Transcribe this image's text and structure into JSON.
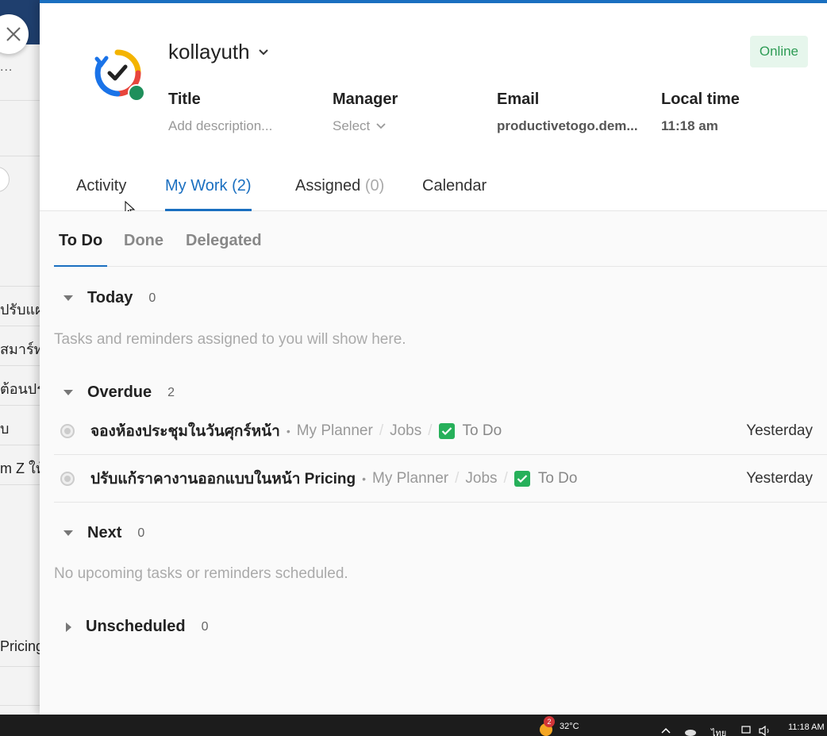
{
  "background_app": {
    "ellipsis": "...",
    "rows": [
      "ปรับแผน",
      "สมาร์ทเก็",
      "ต้อนประ",
      "บ",
      "m Z ให้",
      "Pricing"
    ]
  },
  "profile": {
    "username": "kollayuth",
    "status": "Online",
    "fields": [
      {
        "label": "Title",
        "value": "Add description..."
      },
      {
        "label": "Manager",
        "value": "Select"
      },
      {
        "label": "Email",
        "value": "productivetogo.dem..."
      },
      {
        "label": "Local time",
        "value": "11:18 am"
      }
    ]
  },
  "tabs": [
    {
      "label": "Activity",
      "count": ""
    },
    {
      "label": "My Work",
      "count": "(2)"
    },
    {
      "label": "Assigned",
      "count": "(0)"
    },
    {
      "label": "Calendar",
      "count": ""
    }
  ],
  "subtabs": [
    "To Do",
    "Done",
    "Delegated"
  ],
  "sections": {
    "today": {
      "title": "Today",
      "count": "0",
      "empty": "Tasks and reminders assigned to you will show here."
    },
    "overdue": {
      "title": "Overdue",
      "count": "2"
    },
    "next": {
      "title": "Next",
      "count": "0",
      "empty": "No upcoming tasks or reminders scheduled."
    },
    "unscheduled": {
      "title": "Unscheduled",
      "count": "0"
    }
  },
  "tasks": [
    {
      "title": "จองห้องประชุมในวันศุกร์หน้า",
      "planner": "My Planner",
      "bucket": "Jobs",
      "status": "To Do",
      "due": "Yesterday"
    },
    {
      "title": "ปรับแก้ราคางานออกแบบในหน้า Pricing",
      "planner": "My Planner",
      "bucket": "Jobs",
      "status": "To Do",
      "due": "Yesterday"
    }
  ],
  "taskbar": {
    "notification_count": "2",
    "temperature": "32°C",
    "language": "ไทย",
    "time": "11:18 AM"
  },
  "colors": {
    "accent": "#1a6fc0",
    "online": "#2e9c55",
    "check": "#26b05a"
  }
}
